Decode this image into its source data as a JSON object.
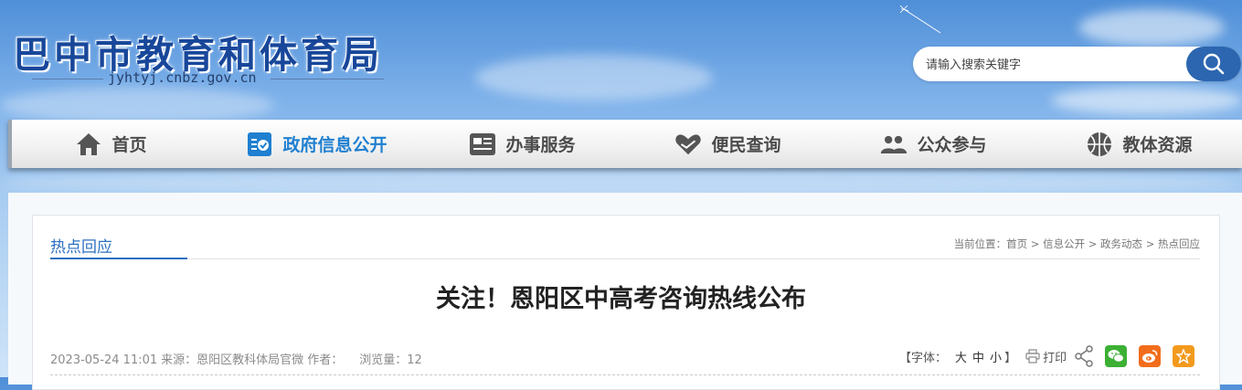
{
  "header": {
    "site_title": "巴中市教育和体育局",
    "domain": "jyhtyj.cnbz.gov.cn"
  },
  "search": {
    "placeholder": "请输入搜索关键字",
    "value": "",
    "icon": "search-icon"
  },
  "nav": {
    "items": [
      {
        "label": "首页",
        "icon": "home-icon"
      },
      {
        "label": "政府信息公开",
        "icon": "gov-info-icon",
        "active": true
      },
      {
        "label": "办事服务",
        "icon": "service-card-icon"
      },
      {
        "label": "便民查询",
        "icon": "heart-hand-icon"
      },
      {
        "label": "公众参与",
        "icon": "people-icon"
      },
      {
        "label": "教体资源",
        "icon": "ball-icon"
      }
    ]
  },
  "category": {
    "title": "热点回应"
  },
  "breadcrumb": {
    "prefix": "当前位置：",
    "items": [
      "首页",
      "信息公开",
      "政务动态",
      "热点回应"
    ],
    "separator": " > "
  },
  "article": {
    "title": "关注！恩阳区中高考咨询热线公布",
    "date": "2023-05-24 11:01",
    "source_label": "来源：",
    "source": "恩阳区教科体局官微",
    "author_label": "作者：",
    "author": "",
    "views_label": "浏览量：",
    "views": "12"
  },
  "tools": {
    "font_label": "【字体：",
    "sizes": [
      "大",
      "中",
      "小"
    ],
    "font_close": "】",
    "print_label": "打印",
    "share_icons": [
      "wechat-icon",
      "weibo-icon",
      "favorite-icon"
    ]
  },
  "colors": {
    "brand_blue": "#18479a",
    "accent_blue": "#2c6fc0",
    "nav_active": "#1f7fd0",
    "wechat_green": "#3cb034",
    "weibo_orange": "#f26d1b",
    "favorite_orange": "#f39a1d"
  }
}
